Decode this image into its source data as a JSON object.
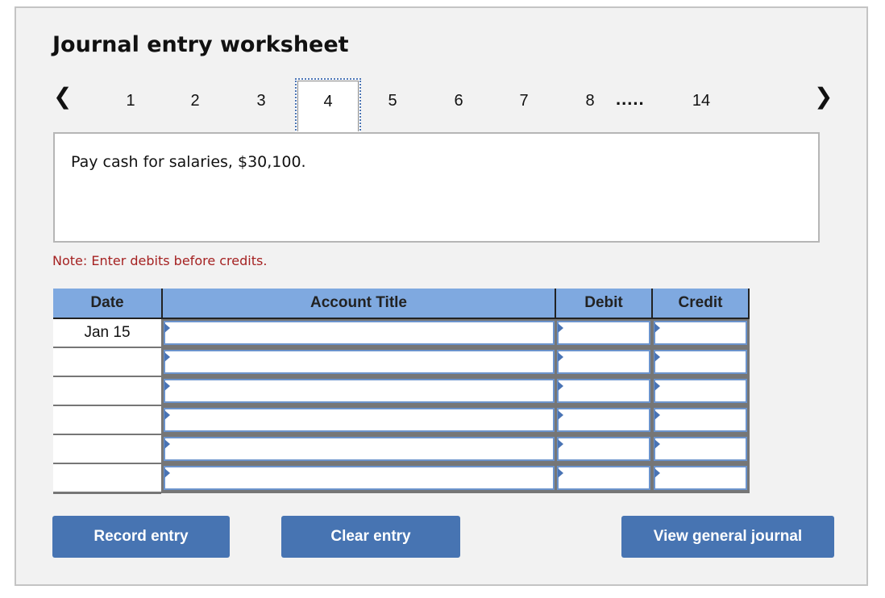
{
  "worksheet": {
    "title": "Journal entry worksheet",
    "pager": {
      "prev_icon": "chevron-left-icon",
      "next_icon": "chevron-right-icon",
      "pages": [
        "1",
        "2",
        "3",
        "4",
        "5",
        "6",
        "7",
        "8"
      ],
      "current_page": "4",
      "ellipsis": ".....",
      "last_page": "14"
    },
    "prompt": "Pay cash for salaries, $30,100.",
    "note": "Note: Enter debits before credits."
  },
  "table": {
    "headers": {
      "date": "Date",
      "account": "Account Title",
      "debit": "Debit",
      "credit": "Credit"
    },
    "rows": [
      {
        "date": "Jan 15",
        "account": "",
        "debit": "",
        "credit": ""
      },
      {
        "date": "",
        "account": "",
        "debit": "",
        "credit": ""
      },
      {
        "date": "",
        "account": "",
        "debit": "",
        "credit": ""
      },
      {
        "date": "",
        "account": "",
        "debit": "",
        "credit": ""
      },
      {
        "date": "",
        "account": "",
        "debit": "",
        "credit": ""
      },
      {
        "date": "",
        "account": "",
        "debit": "",
        "credit": ""
      }
    ]
  },
  "buttons": {
    "record": "Record entry",
    "clear": "Clear entry",
    "view_journal": "View general journal"
  },
  "colors": {
    "button_bg": "#4774b2",
    "header_bg": "#7fa9e0",
    "note_text": "#a52222",
    "panel_bg": "#f2f2f2"
  }
}
